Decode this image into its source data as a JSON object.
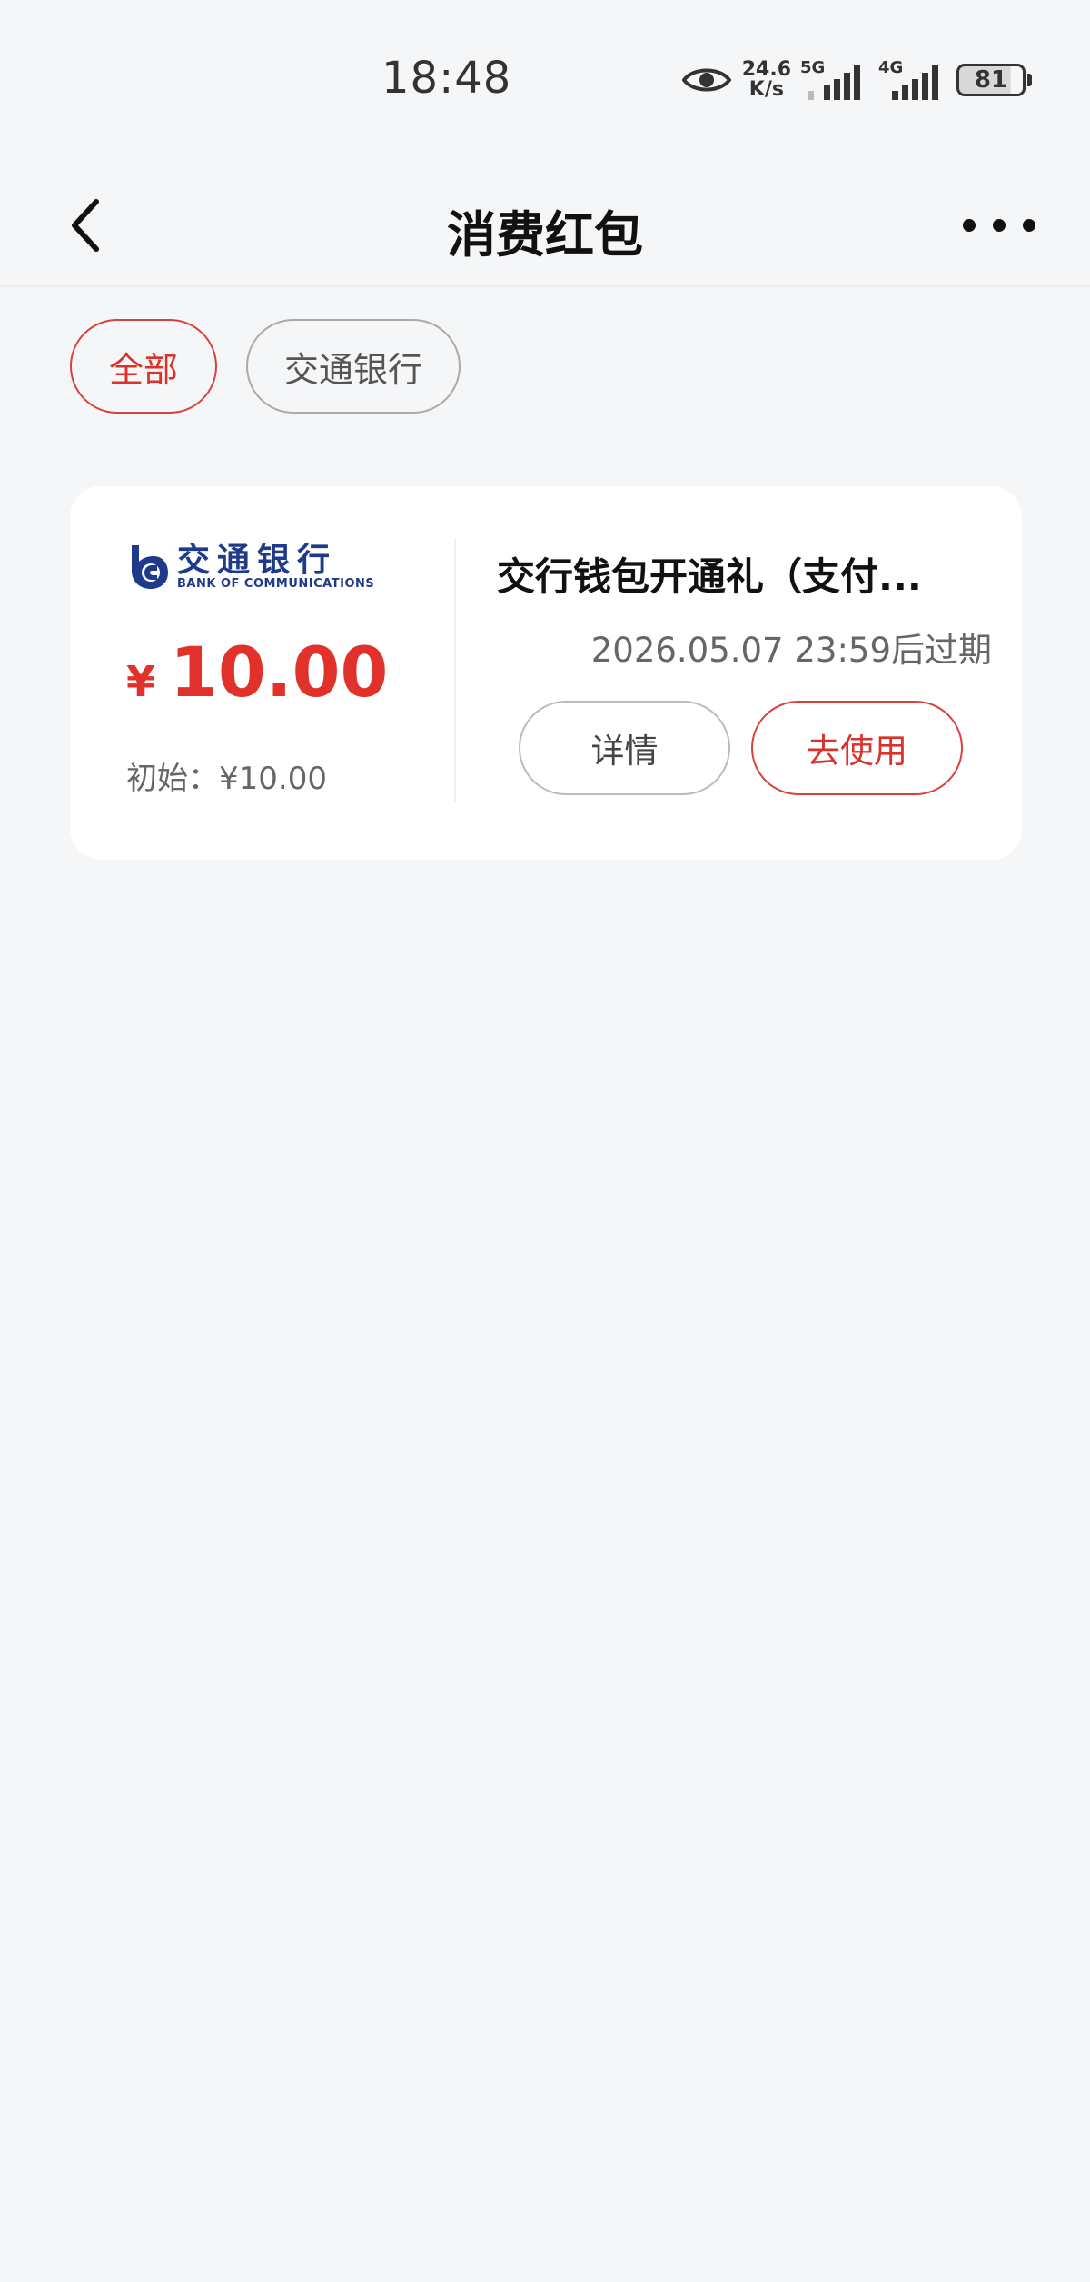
{
  "status_bar": {
    "time": "18:48",
    "net_speed_value": "24.6",
    "net_speed_unit": "K/s",
    "signal_1_gen": "5G",
    "signal_2_gen": "4G",
    "battery_level": "81"
  },
  "nav": {
    "title": "消费红包"
  },
  "filters": [
    {
      "label": "全部",
      "active": true
    },
    {
      "label": "交通银行",
      "active": false
    }
  ],
  "coupon": {
    "bank_name_cn": "交通银行",
    "bank_name_en": "BANK OF COMMUNICATIONS",
    "currency_symbol": "¥",
    "amount": "10.00",
    "initial_label": "初始：¥10.00",
    "title": "交行钱包开通礼（支付...",
    "expiry": "2026.05.07 23:59后过期",
    "detail_button": "详情",
    "use_button": "去使用"
  },
  "colors": {
    "accent_red": "#e0312b",
    "bank_blue": "#1f3a8a",
    "page_background": "#f5f6f8"
  },
  "icons": {
    "back": "chevron-left-icon",
    "more": "more-horizontal-icon",
    "eye": "eye-icon",
    "signal": "signal-icon",
    "battery": "battery-icon",
    "bank_logo": "bank-of-communications-logo"
  }
}
